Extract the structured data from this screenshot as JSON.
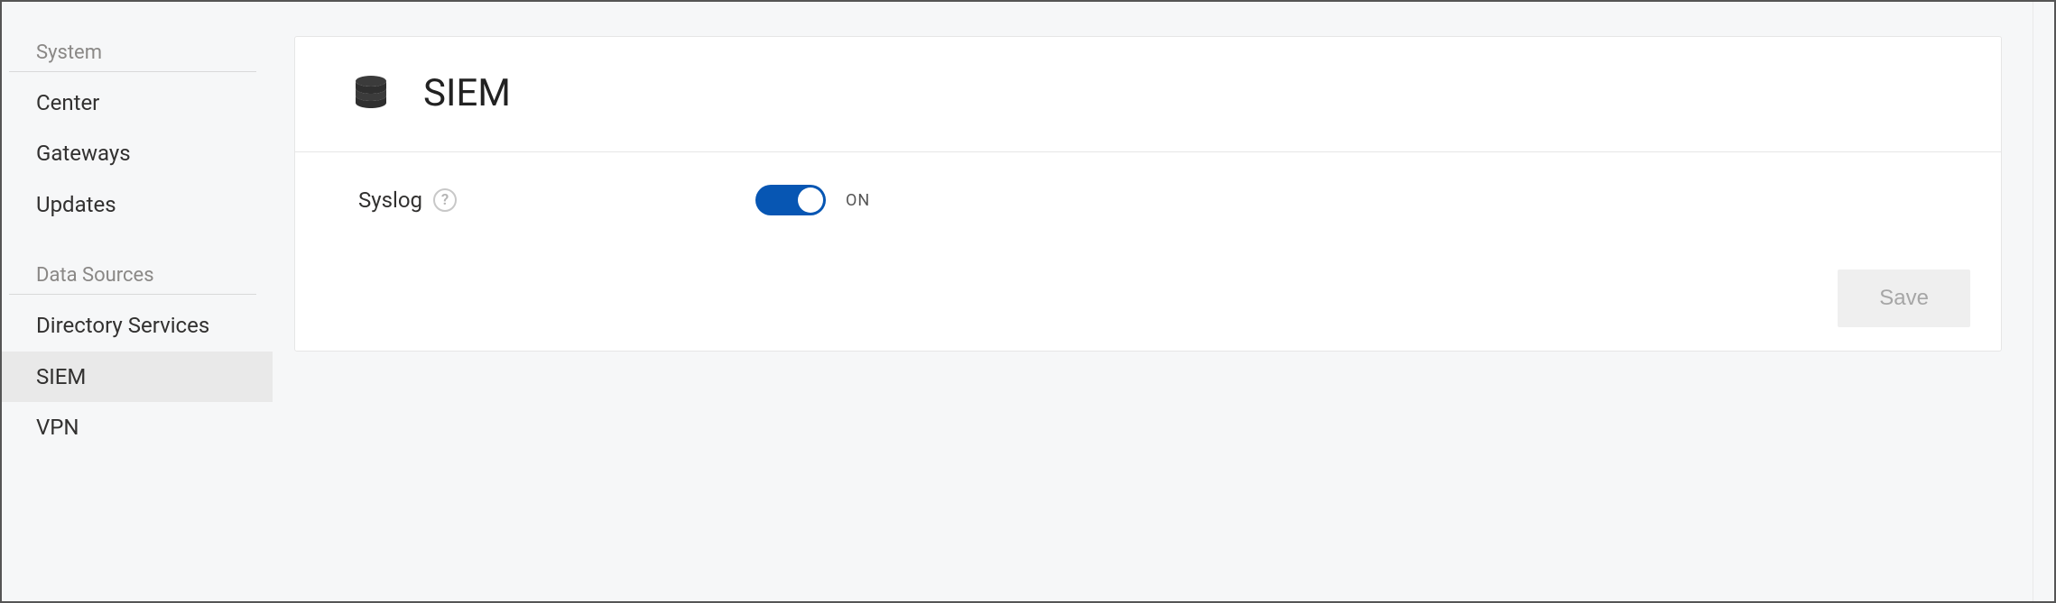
{
  "sidebar": {
    "sections": [
      {
        "label": "System",
        "items": [
          {
            "label": "Center",
            "active": false
          },
          {
            "label": "Gateways",
            "active": false
          },
          {
            "label": "Updates",
            "active": false
          }
        ]
      },
      {
        "label": "Data Sources",
        "items": [
          {
            "label": "Directory Services",
            "active": false
          },
          {
            "label": "SIEM",
            "active": true
          },
          {
            "label": "VPN",
            "active": false
          }
        ]
      }
    ]
  },
  "page": {
    "title": "SIEM",
    "icon": "database-icon"
  },
  "settings": {
    "syslog": {
      "label": "Syslog",
      "enabled": true,
      "state_text": "ON"
    }
  },
  "actions": {
    "save_label": "Save",
    "save_enabled": false
  },
  "colors": {
    "toggle_on": "#0756b3",
    "panel_bg": "#ffffff",
    "page_bg": "#f6f7f8"
  }
}
